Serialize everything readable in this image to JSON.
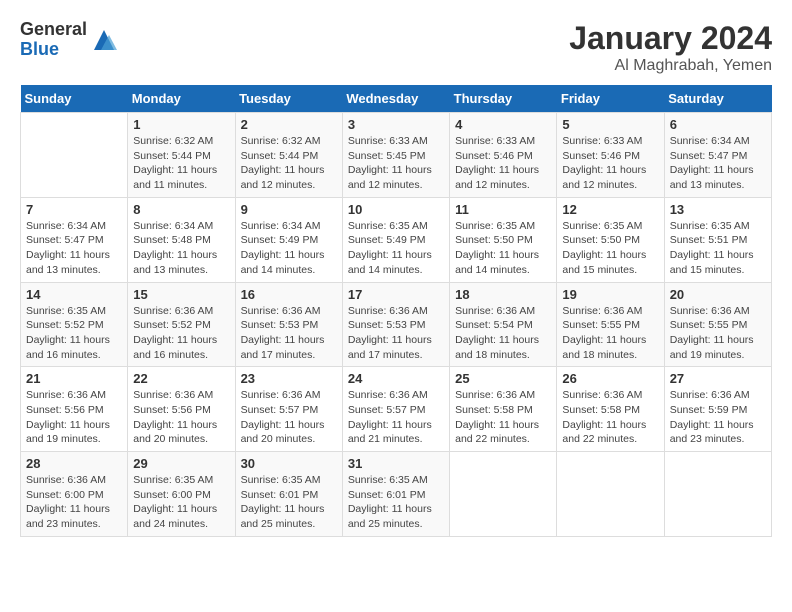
{
  "logo": {
    "general": "General",
    "blue": "Blue"
  },
  "title": {
    "month": "January 2024",
    "location": "Al Maghrabah, Yemen"
  },
  "days_of_week": [
    "Sunday",
    "Monday",
    "Tuesday",
    "Wednesday",
    "Thursday",
    "Friday",
    "Saturday"
  ],
  "weeks": [
    [
      {
        "day": "",
        "info": ""
      },
      {
        "day": "1",
        "info": "Sunrise: 6:32 AM\nSunset: 5:44 PM\nDaylight: 11 hours and 11 minutes."
      },
      {
        "day": "2",
        "info": "Sunrise: 6:32 AM\nSunset: 5:44 PM\nDaylight: 11 hours and 12 minutes."
      },
      {
        "day": "3",
        "info": "Sunrise: 6:33 AM\nSunset: 5:45 PM\nDaylight: 11 hours and 12 minutes."
      },
      {
        "day": "4",
        "info": "Sunrise: 6:33 AM\nSunset: 5:46 PM\nDaylight: 11 hours and 12 minutes."
      },
      {
        "day": "5",
        "info": "Sunrise: 6:33 AM\nSunset: 5:46 PM\nDaylight: 11 hours and 12 minutes."
      },
      {
        "day": "6",
        "info": "Sunrise: 6:34 AM\nSunset: 5:47 PM\nDaylight: 11 hours and 13 minutes."
      }
    ],
    [
      {
        "day": "7",
        "info": "Sunrise: 6:34 AM\nSunset: 5:47 PM\nDaylight: 11 hours and 13 minutes."
      },
      {
        "day": "8",
        "info": "Sunrise: 6:34 AM\nSunset: 5:48 PM\nDaylight: 11 hours and 13 minutes."
      },
      {
        "day": "9",
        "info": "Sunrise: 6:34 AM\nSunset: 5:49 PM\nDaylight: 11 hours and 14 minutes."
      },
      {
        "day": "10",
        "info": "Sunrise: 6:35 AM\nSunset: 5:49 PM\nDaylight: 11 hours and 14 minutes."
      },
      {
        "day": "11",
        "info": "Sunrise: 6:35 AM\nSunset: 5:50 PM\nDaylight: 11 hours and 14 minutes."
      },
      {
        "day": "12",
        "info": "Sunrise: 6:35 AM\nSunset: 5:50 PM\nDaylight: 11 hours and 15 minutes."
      },
      {
        "day": "13",
        "info": "Sunrise: 6:35 AM\nSunset: 5:51 PM\nDaylight: 11 hours and 15 minutes."
      }
    ],
    [
      {
        "day": "14",
        "info": "Sunrise: 6:35 AM\nSunset: 5:52 PM\nDaylight: 11 hours and 16 minutes."
      },
      {
        "day": "15",
        "info": "Sunrise: 6:36 AM\nSunset: 5:52 PM\nDaylight: 11 hours and 16 minutes."
      },
      {
        "day": "16",
        "info": "Sunrise: 6:36 AM\nSunset: 5:53 PM\nDaylight: 11 hours and 17 minutes."
      },
      {
        "day": "17",
        "info": "Sunrise: 6:36 AM\nSunset: 5:53 PM\nDaylight: 11 hours and 17 minutes."
      },
      {
        "day": "18",
        "info": "Sunrise: 6:36 AM\nSunset: 5:54 PM\nDaylight: 11 hours and 18 minutes."
      },
      {
        "day": "19",
        "info": "Sunrise: 6:36 AM\nSunset: 5:55 PM\nDaylight: 11 hours and 18 minutes."
      },
      {
        "day": "20",
        "info": "Sunrise: 6:36 AM\nSunset: 5:55 PM\nDaylight: 11 hours and 19 minutes."
      }
    ],
    [
      {
        "day": "21",
        "info": "Sunrise: 6:36 AM\nSunset: 5:56 PM\nDaylight: 11 hours and 19 minutes."
      },
      {
        "day": "22",
        "info": "Sunrise: 6:36 AM\nSunset: 5:56 PM\nDaylight: 11 hours and 20 minutes."
      },
      {
        "day": "23",
        "info": "Sunrise: 6:36 AM\nSunset: 5:57 PM\nDaylight: 11 hours and 20 minutes."
      },
      {
        "day": "24",
        "info": "Sunrise: 6:36 AM\nSunset: 5:57 PM\nDaylight: 11 hours and 21 minutes."
      },
      {
        "day": "25",
        "info": "Sunrise: 6:36 AM\nSunset: 5:58 PM\nDaylight: 11 hours and 22 minutes."
      },
      {
        "day": "26",
        "info": "Sunrise: 6:36 AM\nSunset: 5:58 PM\nDaylight: 11 hours and 22 minutes."
      },
      {
        "day": "27",
        "info": "Sunrise: 6:36 AM\nSunset: 5:59 PM\nDaylight: 11 hours and 23 minutes."
      }
    ],
    [
      {
        "day": "28",
        "info": "Sunrise: 6:36 AM\nSunset: 6:00 PM\nDaylight: 11 hours and 23 minutes."
      },
      {
        "day": "29",
        "info": "Sunrise: 6:35 AM\nSunset: 6:00 PM\nDaylight: 11 hours and 24 minutes."
      },
      {
        "day": "30",
        "info": "Sunrise: 6:35 AM\nSunset: 6:01 PM\nDaylight: 11 hours and 25 minutes."
      },
      {
        "day": "31",
        "info": "Sunrise: 6:35 AM\nSunset: 6:01 PM\nDaylight: 11 hours and 25 minutes."
      },
      {
        "day": "",
        "info": ""
      },
      {
        "day": "",
        "info": ""
      },
      {
        "day": "",
        "info": ""
      }
    ]
  ]
}
